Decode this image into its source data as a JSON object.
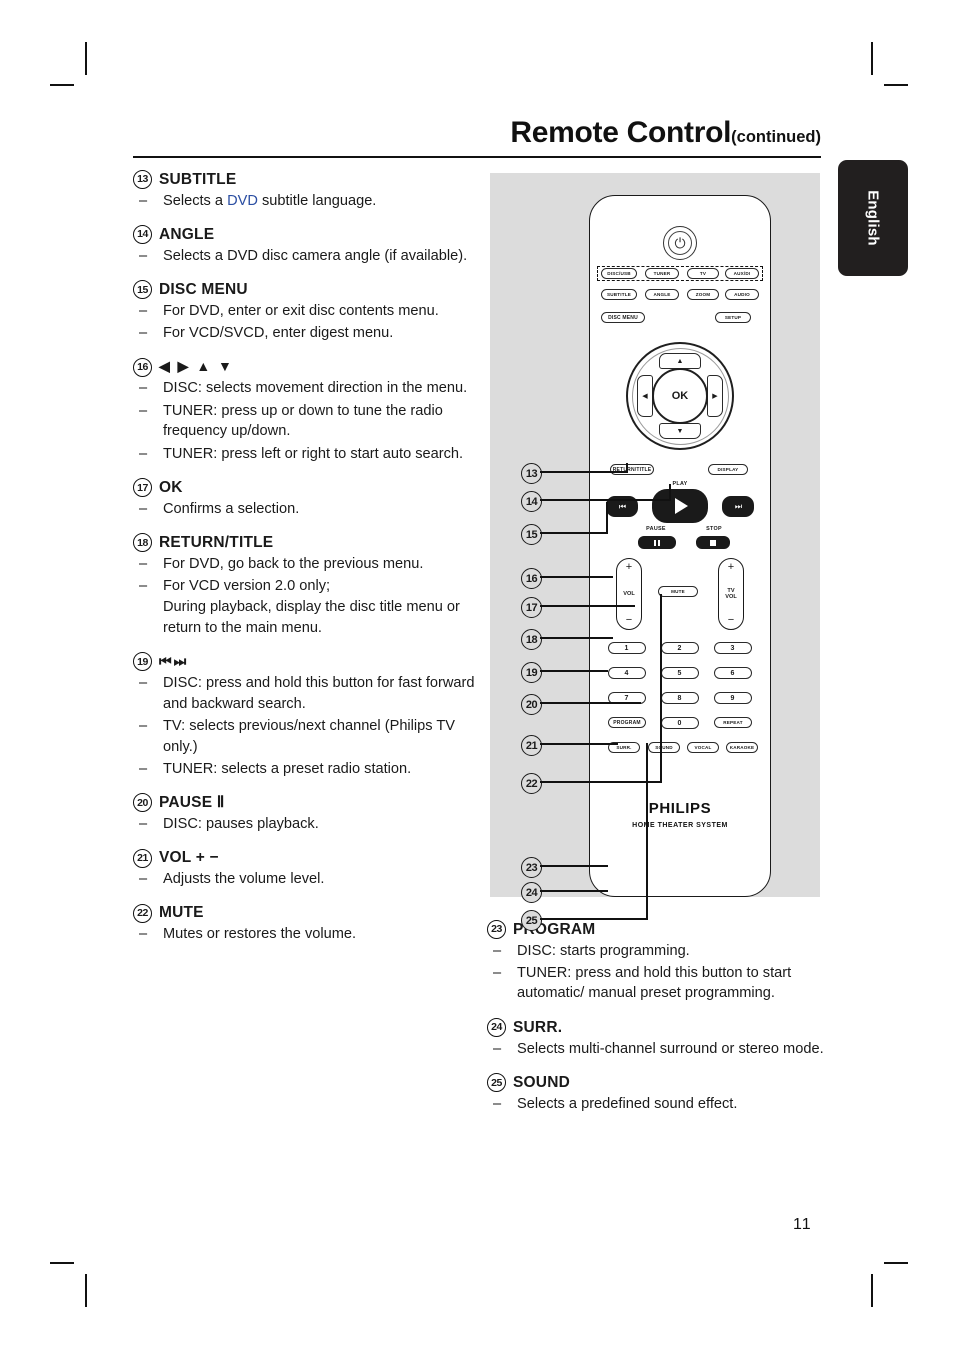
{
  "header": {
    "title": "Remote Control",
    "continued": "(continued)"
  },
  "language_tab": {
    "label": "English"
  },
  "page_number": "11",
  "left_column": [
    {
      "num": "13",
      "label": "SUBTITLE",
      "bullets": [
        "Selects a DVD subtitle language."
      ],
      "highlight": "DVD"
    },
    {
      "num": "14",
      "label": "ANGLE",
      "bullets": [
        "Selects a DVD disc camera angle (if available)."
      ]
    },
    {
      "num": "15",
      "label": "DISC MENU",
      "bullets": [
        "For DVD, enter or exit disc contents menu.",
        "For VCD/SVCD, enter digest menu."
      ]
    },
    {
      "num": "16",
      "label": "◀ ▶ ▲ ▼",
      "bullets": [
        "DISC: selects movement direction in the menu.",
        "TUNER: press up or down to tune the radio frequency up/down.",
        "TUNER: press left or right to start auto search."
      ]
    },
    {
      "num": "17",
      "label": "OK",
      "bullets": [
        "Confirms a selection."
      ]
    },
    {
      "num": "18",
      "label": "RETURN/TITLE",
      "bullets": [
        "For DVD, go back to the previous menu.",
        "For VCD version 2.0 only; During playback, display the disc title menu or return to the main menu."
      ]
    },
    {
      "num": "19",
      "label": "⏮⏭",
      "bullets": [
        "DISC: press and hold this button for fast forward and backward search.",
        "TV: selects previous/next channel (Philips TV only.)",
        "TUNER: selects a preset radio station."
      ]
    },
    {
      "num": "20",
      "label": "PAUSE Ⅱ",
      "bullets": [
        "DISC: pauses playback."
      ]
    },
    {
      "num": "21",
      "label": "VOL + −",
      "bullets": [
        "Adjusts the volume level."
      ]
    },
    {
      "num": "22",
      "label": "MUTE",
      "bullets": [
        "Mutes or restores the volume."
      ]
    }
  ],
  "right_column": [
    {
      "num": "23",
      "label": "PROGRAM",
      "bullets": [
        "DISC: starts programming.",
        "TUNER: press and hold this button to start automatic/ manual preset programming."
      ]
    },
    {
      "num": "24",
      "label": "SURR.",
      "bullets": [
        "Selects multi-channel surround or stereo mode."
      ]
    },
    {
      "num": "25",
      "label": "SOUND",
      "bullets": [
        "Selects a predefined sound effect."
      ]
    }
  ],
  "remote": {
    "power_icon": "power-icon",
    "source_row": [
      "DISC/USB",
      "TUNER",
      "TV",
      "AUX/DI"
    ],
    "function_row": [
      "SUBTITLE",
      "ANGLE",
      "ZOOM",
      "AUDIO"
    ],
    "menu_row": {
      "left": "DISC MENU",
      "right": "SETUP"
    },
    "nav": {
      "ok": "OK",
      "up": "▲",
      "down": "▼",
      "left": "◀",
      "right": "▶"
    },
    "return_row": {
      "left": "RETURN/TITLE",
      "right": "DISPLAY"
    },
    "transport": {
      "play_caption": "PLAY",
      "pause_caption": "PAUSE",
      "stop_caption": "STOP",
      "prev": "⏮",
      "next": "⏭"
    },
    "volume": {
      "left_name": "VOL",
      "right_name": "TV\nVOL",
      "plus": "+",
      "minus": "−",
      "mute": "MUTE"
    },
    "keypad": [
      "1",
      "2",
      "3",
      "4",
      "5",
      "6",
      "7",
      "8",
      "9"
    ],
    "program_row": [
      "PROGRAM",
      "0",
      "REPEAT"
    ],
    "sound_row": [
      "SURR.",
      "SOUND",
      "VOCAL",
      "KARAOKE"
    ],
    "brand": "PHILIPS",
    "brand_sub": "HOME THEATER SYSTEM",
    "callouts": [
      "13",
      "14",
      "15",
      "16",
      "17",
      "18",
      "19",
      "20",
      "21",
      "22",
      "23",
      "24",
      "25"
    ]
  },
  "colors": {
    "panel_gray": "#dcdcdc",
    "ink": "#1a1a1a",
    "accent_blue": "#2b4ea2",
    "tab_dark": "#221f1f"
  }
}
